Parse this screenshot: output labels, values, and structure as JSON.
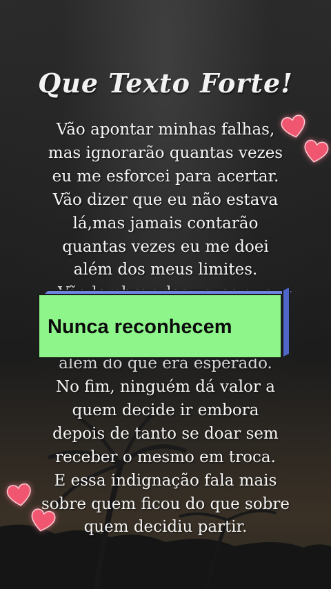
{
  "title": "Que Texto Forte!",
  "poem": {
    "lines": [
      "Vão apontar minhas falhas,",
      "mas ignorarão quantas vezes",
      "eu me esforcei para acertar.",
      "Vão dizer que eu não estava",
      "lá,mas jamais contarão",
      "quantas vezes eu me doei",
      "além dos meus limites.",
      "Vão lembrar das vezes que",
      "",
      "",
      "além do que era esperado.",
      "No fim, ninguém dá valor a",
      "quem decide ir embora",
      "depois de tanto se doar sem",
      "receber o mesmo em troca.",
      "E essa indignação fala mais",
      "sobre quem ficou do que sobre",
      "quem decidiu partir."
    ]
  },
  "banner": {
    "text": "Nunca reconhecem",
    "face_color": "#8ef58a",
    "side_color": "#4f66c9"
  },
  "decorations": {
    "icon": "heart-icon",
    "heart_color": "#f0566f"
  }
}
